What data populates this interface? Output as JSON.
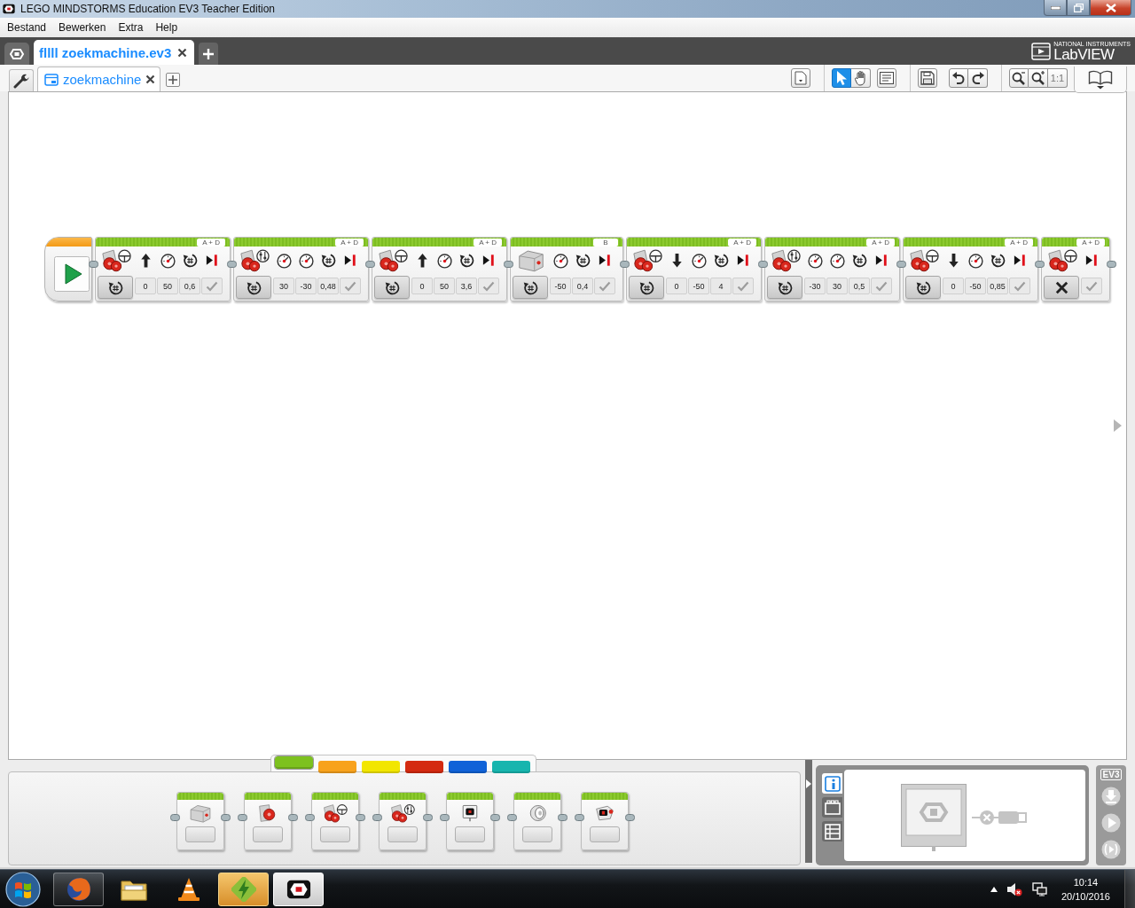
{
  "window": {
    "title": "LEGO MINDSTORMS Education EV3 Teacher Edition"
  },
  "menu": [
    {
      "label": "Bestand"
    },
    {
      "label": "Bewerken"
    },
    {
      "label": "Extra"
    },
    {
      "label": "Help"
    }
  ],
  "project_tabs": [
    {
      "label": "fllll zoekmachine.ev3",
      "selected": true
    }
  ],
  "logo": {
    "maker": "NATIONAL INSTRUMENTS",
    "name": "LabVIEW"
  },
  "program_tabs": [
    {
      "label": "zoekmachine",
      "selected": true
    }
  ],
  "toolbar": {
    "tools": [
      {
        "kind": "pointer",
        "selected": true
      },
      {
        "kind": "pan",
        "selected": false
      }
    ],
    "zoom_reset": "1:1"
  },
  "program": {
    "blocks": [
      {
        "kind": "move_steering",
        "port": "A + D",
        "mode_button": {
          "kind": "rotations"
        },
        "params": [
          {
            "kind": "steering_up",
            "value": "0"
          },
          {
            "kind": "power",
            "value": "50"
          },
          {
            "kind": "rotations",
            "value": "0,6"
          },
          {
            "kind": "brake",
            "checked": true
          }
        ]
      },
      {
        "kind": "move_tank",
        "port": "A + D",
        "mode_button": {
          "kind": "rotations"
        },
        "params": [
          {
            "kind": "power",
            "value": "30"
          },
          {
            "kind": "power",
            "value": "-30"
          },
          {
            "kind": "rotations",
            "value": "0,48"
          },
          {
            "kind": "brake",
            "checked": true
          }
        ]
      },
      {
        "kind": "move_steering",
        "port": "A + D",
        "mode_button": {
          "kind": "rotations"
        },
        "params": [
          {
            "kind": "steering_up",
            "value": "0"
          },
          {
            "kind": "power",
            "value": "50"
          },
          {
            "kind": "rotations",
            "value": "3,6"
          },
          {
            "kind": "brake",
            "checked": true
          }
        ]
      },
      {
        "kind": "medium_motor",
        "port": "B",
        "mode_button": {
          "kind": "rotations"
        },
        "params": [
          {
            "kind": "power",
            "value": "-50"
          },
          {
            "kind": "rotations",
            "value": "0,4"
          },
          {
            "kind": "brake",
            "checked": true
          }
        ]
      },
      {
        "kind": "move_steering",
        "port": "A + D",
        "mode_button": {
          "kind": "rotations"
        },
        "params": [
          {
            "kind": "steering_down",
            "value": "0"
          },
          {
            "kind": "power",
            "value": "-50"
          },
          {
            "kind": "rotations",
            "value": "4"
          },
          {
            "kind": "brake",
            "checked": true
          }
        ]
      },
      {
        "kind": "move_tank",
        "port": "A + D",
        "mode_button": {
          "kind": "rotations"
        },
        "params": [
          {
            "kind": "power",
            "value": "-30"
          },
          {
            "kind": "power",
            "value": "30"
          },
          {
            "kind": "rotations",
            "value": "0,5"
          },
          {
            "kind": "brake",
            "checked": true
          }
        ]
      },
      {
        "kind": "move_steering",
        "port": "A + D",
        "mode_button": {
          "kind": "rotations"
        },
        "params": [
          {
            "kind": "steering_down",
            "value": "0"
          },
          {
            "kind": "power",
            "value": "-50"
          },
          {
            "kind": "rotations",
            "value": "0,85"
          },
          {
            "kind": "brake",
            "checked": true
          }
        ]
      },
      {
        "kind": "move_steering",
        "port": "A + D",
        "mode_button": {
          "kind": "off"
        },
        "params": [
          {
            "kind": "brake",
            "checked": true
          }
        ]
      }
    ]
  },
  "palette": {
    "tabs": [
      {
        "color": "#7dc11f",
        "selected": true
      },
      {
        "color": "#f8a21c",
        "selected": false
      },
      {
        "color": "#f2e600",
        "selected": false
      },
      {
        "color": "#d42a10",
        "selected": false
      },
      {
        "color": "#1062d8",
        "selected": false
      },
      {
        "color": "#17b5ae",
        "selected": false
      }
    ],
    "blocks": [
      {
        "kind": "medium_motor"
      },
      {
        "kind": "large_motor"
      },
      {
        "kind": "move_steering"
      },
      {
        "kind": "move_tank"
      },
      {
        "kind": "display"
      },
      {
        "kind": "sound"
      },
      {
        "kind": "brick_status_light"
      }
    ]
  },
  "hardware_page": {
    "tabs": [
      {
        "kind": "brick_info",
        "selected": true
      },
      {
        "kind": "port_view",
        "selected": false
      },
      {
        "kind": "available_bricks",
        "selected": false
      }
    ],
    "connected": false
  },
  "brick_controls": {
    "label": "EV3"
  },
  "taskbar": {
    "apps": [
      {
        "kind": "browser",
        "running": true,
        "flashing": false,
        "selected": false
      },
      {
        "kind": "file_explorer",
        "running": false,
        "flashing": false,
        "selected": false
      },
      {
        "kind": "media_player",
        "running": false,
        "flashing": false,
        "selected": false
      },
      {
        "kind": "bolt_app",
        "running": true,
        "flashing": true,
        "selected": false
      },
      {
        "kind": "ev3",
        "running": true,
        "flashing": false,
        "selected": true
      }
    ],
    "clock": {
      "time": "10:14",
      "date": "20/10/2016"
    }
  }
}
